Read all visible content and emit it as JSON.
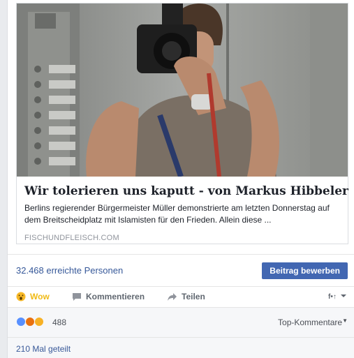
{
  "card": {
    "image_alt": "Mirror selfie with camera",
    "title": "Wir tolerieren uns kaputt - von Markus Hibbeler",
    "description": "Berlins regierender Bürgermeister Müller demonstrierte am letzten Donnerstag auf dem Breitscheidplatz mit Islamisten für den Frieden. Allein diese ...",
    "domain": "FISCHUNDFLEISCH.COM"
  },
  "reach": {
    "text": "32.468 erreichte Personen",
    "boost_label": "Beitrag bewerben"
  },
  "actions": {
    "wow_label": "Wow",
    "comment_label": "Kommentieren",
    "share_label": "Teilen",
    "audience_icon": "friends-icon"
  },
  "reactions": {
    "icons": [
      "like",
      "angry",
      "wow"
    ],
    "count": "488",
    "sort_label": "Top-Kommentare"
  },
  "shares": {
    "text": "210 Mal geteilt"
  },
  "colors": {
    "link_blue": "#365899",
    "button_blue": "#4267b2",
    "wow_yellow": "#f0ba15"
  }
}
